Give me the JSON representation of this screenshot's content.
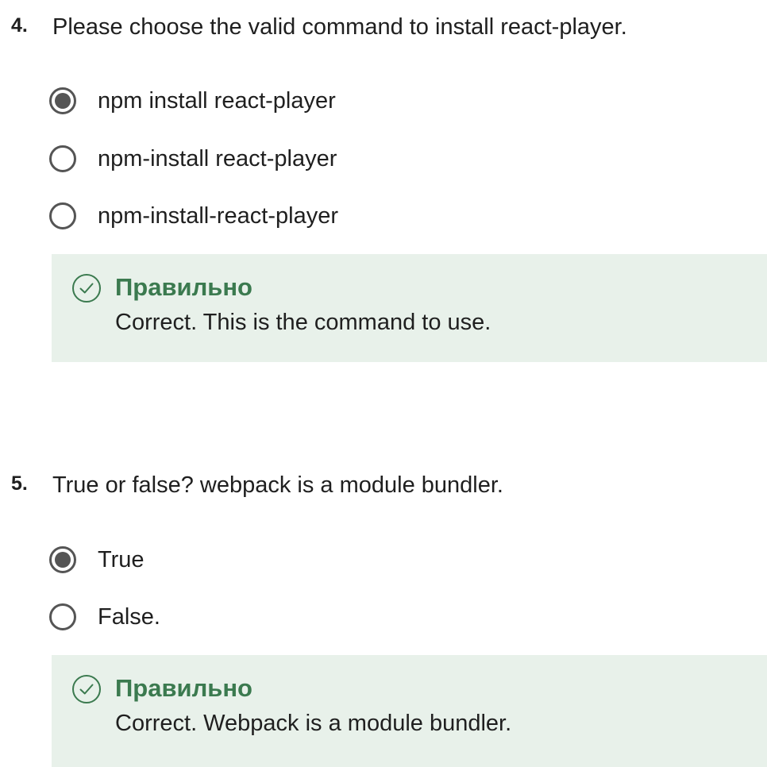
{
  "questions": [
    {
      "number": "4.",
      "text": "Please choose the valid command to install react-player.",
      "options": [
        {
          "label": "npm install react-player",
          "selected": true
        },
        {
          "label": "npm-install react-player",
          "selected": false
        },
        {
          "label": "npm-install-react-player",
          "selected": false
        }
      ],
      "feedback": {
        "title": "Правильно",
        "text": "Correct. This is the command to use.",
        "icon": "check-circle-icon"
      }
    },
    {
      "number": "5.",
      "text": "True or false? webpack is a module bundler.",
      "options": [
        {
          "label": "True",
          "selected": true
        },
        {
          "label": "False.",
          "selected": false
        }
      ],
      "feedback": {
        "title": "Правильно",
        "text": "Correct. Webpack is a module bundler.",
        "icon": "check-circle-icon"
      }
    }
  ],
  "colors": {
    "feedback_bg": "#e8f1ea",
    "success": "#3b7a4f",
    "radio": "#555555"
  }
}
